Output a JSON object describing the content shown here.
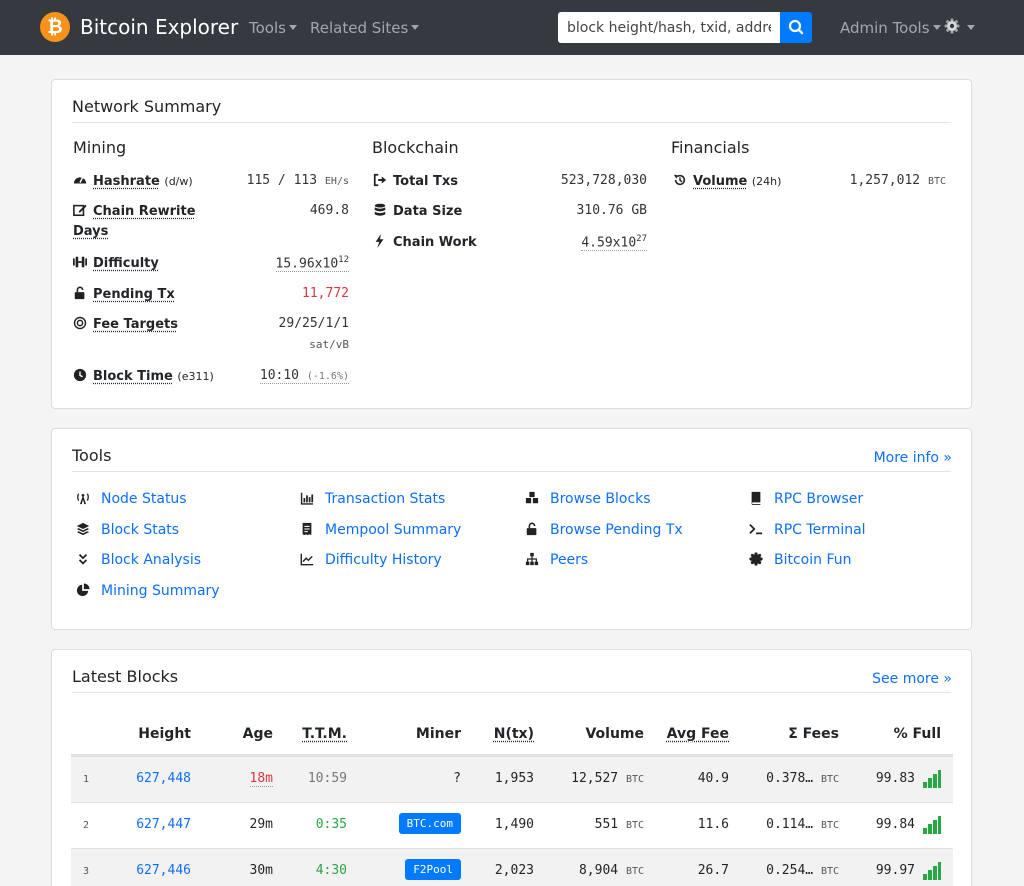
{
  "nav": {
    "brand": "Bitcoin Explorer",
    "tools": "Tools",
    "related": "Related Sites",
    "search_placeholder": "block height/hash, txid, address",
    "admin": "Admin Tools"
  },
  "summary": {
    "title": "Network Summary",
    "mining": {
      "heading": "Mining",
      "hashrate_label": "Hashrate",
      "hashrate_sub": "(d/w)",
      "hashrate_value": "115 / 113",
      "hashrate_unit": "EH/s",
      "rewrite_label_1": "Chain Rewrite",
      "rewrite_label_2": "Days",
      "rewrite_value": "469.8",
      "difficulty_label": "Difficulty",
      "difficulty_value": "15.96x10",
      "difficulty_exp": "12",
      "pending_label": "Pending Tx",
      "pending_value": "11,772",
      "fee_label": "Fee Targets",
      "fee_value": "29/25/1/1",
      "fee_unit": "sat/vB",
      "blocktime_label": "Block Time",
      "blocktime_sub": "(e311)",
      "blocktime_value": "10:10",
      "blocktime_delta": "(-1.6%)"
    },
    "blockchain": {
      "heading": "Blockchain",
      "txs_label": "Total Txs",
      "txs_value": "523,728,030",
      "size_label": "Data Size",
      "size_value": "310.76 GB",
      "work_label": "Chain Work",
      "work_value": "4.59x10",
      "work_exp": "27"
    },
    "financials": {
      "heading": "Financials",
      "volume_label": "Volume",
      "volume_sub": "(24h)",
      "volume_value": "1,257,012",
      "volume_unit": "BTC"
    }
  },
  "tools": {
    "title": "Tools",
    "more": "More info »",
    "items": [
      {
        "label": "Node Status",
        "icon": "tower-icon"
      },
      {
        "label": "Block Stats",
        "icon": "layers-icon"
      },
      {
        "label": "Block Analysis",
        "icon": "angles-down-icon"
      },
      {
        "label": "Mining Summary",
        "icon": "pie-icon"
      },
      {
        "label": "Transaction Stats",
        "icon": "bar-chart-icon"
      },
      {
        "label": "Mempool Summary",
        "icon": "receipt-icon"
      },
      {
        "label": "Difficulty History",
        "icon": "line-chart-icon"
      },
      {
        "label": "Browse Blocks",
        "icon": "cubes-icon"
      },
      {
        "label": "Browse Pending Tx",
        "icon": "unlock-icon"
      },
      {
        "label": "Peers",
        "icon": "network-icon"
      },
      {
        "label": "RPC Browser",
        "icon": "book-icon"
      },
      {
        "label": "RPC Terminal",
        "icon": "terminal-icon"
      },
      {
        "label": "Bitcoin Fun",
        "icon": "certificate-icon"
      }
    ]
  },
  "blocks": {
    "title": "Latest Blocks",
    "more": "See more »",
    "headers": [
      "Height",
      "Age",
      "T.T.M.",
      "Miner",
      "N(tx)",
      "Volume",
      "Avg Fee",
      "Σ Fees",
      "% Full"
    ],
    "rows": [
      {
        "idx": "1",
        "height": "627,448",
        "age": "18m",
        "ttm": "10:59",
        "miner": "?",
        "ntx": "1,953",
        "volume": "12,527",
        "unit": "BTC",
        "avgfee": "40.9",
        "fees": "0.378…",
        "full": "99.83"
      },
      {
        "idx": "2",
        "height": "627,447",
        "age": "29m",
        "ttm": "0:35",
        "miner": "BTC.com",
        "ntx": "1,490",
        "volume": "551",
        "unit": "BTC",
        "avgfee": "11.6",
        "fees": "0.114…",
        "full": "99.84"
      },
      {
        "idx": "3",
        "height": "627,446",
        "age": "30m",
        "ttm": "4:30",
        "miner": "F2Pool",
        "ntx": "2,023",
        "volume": "8,904",
        "unit": "BTC",
        "avgfee": "26.7",
        "fees": "0.254…",
        "full": "99.97"
      }
    ]
  },
  "colors": {
    "navbar": "#343a40",
    "accent": "#007bff",
    "bitcoin": "#f7931a",
    "danger": "#dc3545",
    "success": "#28a745"
  }
}
